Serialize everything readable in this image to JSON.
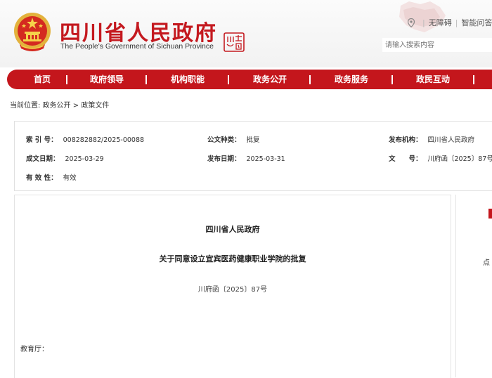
{
  "header": {
    "title_cn": "四川省人民政府",
    "title_en": "The People's Government of Sichuan Province",
    "seal_text": "四中川國",
    "links": [
      "无障碍",
      "智能问答"
    ],
    "search_placeholder": "请输入搜索内容"
  },
  "nav": {
    "items": [
      "首页",
      "政府领导",
      "机构职能",
      "政务公开",
      "政务服务",
      "政民互动"
    ]
  },
  "breadcrumb": {
    "label": "当前位置:",
    "items": [
      "政务公开",
      "政策文件"
    ],
    "separator": ">"
  },
  "meta": {
    "index_label": "索 引 号：",
    "index_value": "008282882/2025-00088",
    "category_label": "公文种类：",
    "category_value": "批复",
    "issuer_label": "发布机构：",
    "issuer_value": "四川省人民政府",
    "written_label": "成文日期：",
    "written_value": "2025-03-29",
    "published_label": "发布日期：",
    "published_value": "2025-03-31",
    "docno_label": "文　　号：",
    "docno_value": "川府函〔2025〕87号",
    "validity_label": "有 效 性：",
    "validity_value": "有效"
  },
  "document": {
    "issuer": "四川省人民政府",
    "title": "关于同意设立宜宾医药健康职业学院的批复",
    "number": "川府函〔2025〕87号",
    "salutation": "教育厅："
  },
  "side": {
    "text": "点"
  },
  "colors": {
    "brand_red": "#c4161c",
    "title_red": "#c4191f"
  }
}
